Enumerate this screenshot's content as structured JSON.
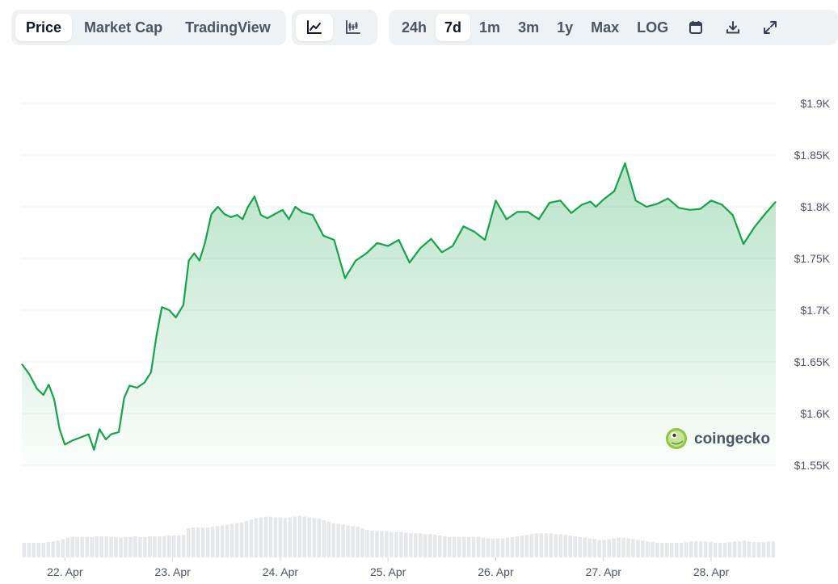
{
  "toolbar": {
    "type_tabs": [
      {
        "label": "Price",
        "active": true
      },
      {
        "label": "Market Cap",
        "active": false
      },
      {
        "label": "TradingView",
        "active": false
      }
    ],
    "view_buttons": [
      {
        "icon": "line-chart-icon",
        "active": true
      },
      {
        "icon": "candlestick-chart-icon",
        "active": false
      }
    ],
    "ranges": [
      {
        "label": "24h",
        "active": false
      },
      {
        "label": "7d",
        "active": true
      },
      {
        "label": "1m",
        "active": false
      },
      {
        "label": "3m",
        "active": false
      },
      {
        "label": "1y",
        "active": false
      },
      {
        "label": "Max",
        "active": false
      },
      {
        "label": "LOG",
        "active": false
      }
    ],
    "actions": [
      {
        "icon": "calendar-icon"
      },
      {
        "icon": "download-icon"
      },
      {
        "icon": "expand-icon"
      }
    ]
  },
  "watermark": {
    "text": "coingecko",
    "icon": "coingecko-logo-icon"
  },
  "colors": {
    "line": "#16a34a",
    "fill": "#bbf7d0",
    "volume": "#e5e7eb",
    "grid": "#eef0f3"
  },
  "chart_data": {
    "type": "area",
    "ylim": [
      1550,
      1900
    ],
    "y_ticks": [
      1550,
      1600,
      1650,
      1700,
      1750,
      1800,
      1850,
      1900
    ],
    "y_tick_labels": [
      "$1.55K",
      "$1.6K",
      "$1.65K",
      "$1.7K",
      "$1.75K",
      "$1.8K",
      "$1.85K",
      "$1.9K"
    ],
    "xlim": [
      0,
      7
    ],
    "x_ticks": [
      0.4,
      1.4,
      2.4,
      3.4,
      4.4,
      5.4,
      6.4
    ],
    "x_tick_labels": [
      "22. Apr",
      "23. Apr",
      "24. Apr",
      "25. Apr",
      "26. Apr",
      "27. Apr",
      "28. Apr"
    ],
    "grid": true,
    "legend": "none",
    "series": [
      {
        "x": [
          0,
          0.07,
          0.14,
          0.2,
          0.25,
          0.3,
          0.35,
          0.4,
          0.47,
          0.55,
          0.62,
          0.67,
          0.72,
          0.78,
          0.83,
          0.9,
          0.95,
          1.0,
          1.07,
          1.14,
          1.2,
          1.25,
          1.3,
          1.37,
          1.43,
          1.5,
          1.55,
          1.6,
          1.65,
          1.7,
          1.76,
          1.82,
          1.88,
          1.94,
          2.0,
          2.05,
          2.1,
          2.16,
          2.22,
          2.28,
          2.35,
          2.42,
          2.48,
          2.54,
          2.6,
          2.7,
          2.8,
          2.9,
          3.0,
          3.1,
          3.2,
          3.3,
          3.4,
          3.5,
          3.6,
          3.7,
          3.8,
          3.9,
          4.0,
          4.1,
          4.2,
          4.3,
          4.4,
          4.5,
          4.6,
          4.7,
          4.8,
          4.9,
          5.0,
          5.1,
          5.2,
          5.28,
          5.33,
          5.4,
          5.5,
          5.6,
          5.7,
          5.8,
          5.9,
          6.0,
          6.1,
          6.2,
          6.3,
          6.4,
          6.5,
          6.6,
          6.7,
          6.8,
          6.9,
          7.0
        ],
        "y": [
          1648,
          1638,
          1624,
          1618,
          1628,
          1614,
          1585,
          1570,
          1574,
          1577,
          1580,
          1565,
          1585,
          1575,
          1580,
          1582,
          1615,
          1627,
          1625,
          1630,
          1640,
          1675,
          1703,
          1700,
          1693,
          1705,
          1748,
          1755,
          1748,
          1765,
          1793,
          1800,
          1793,
          1790,
          1792,
          1788,
          1800,
          1810,
          1792,
          1789,
          1793,
          1797,
          1788,
          1800,
          1795,
          1792,
          1772,
          1768,
          1731,
          1748,
          1755,
          1765,
          1762,
          1768,
          1746,
          1760,
          1769,
          1756,
          1762,
          1781,
          1776,
          1768,
          1806,
          1788,
          1795,
          1795,
          1788,
          1804,
          1806,
          1794,
          1802,
          1805,
          1800,
          1807,
          1815,
          1842,
          1806,
          1800,
          1803,
          1808,
          1799,
          1797,
          1798,
          1806,
          1802,
          1792,
          1764,
          1780,
          1793,
          1805
        ]
      }
    ],
    "volume": [
      0.2,
      0.2,
      0.2,
      0.2,
      0.2,
      0.21,
      0.22,
      0.23,
      0.25,
      0.27,
      0.28,
      0.28,
      0.28,
      0.28,
      0.28,
      0.29,
      0.29,
      0.29,
      0.28,
      0.28,
      0.27,
      0.28,
      0.28,
      0.29,
      0.28,
      0.28,
      0.29,
      0.29,
      0.29,
      0.29,
      0.3,
      0.3,
      0.3,
      0.31,
      0.4,
      0.41,
      0.41,
      0.41,
      0.41,
      0.42,
      0.43,
      0.44,
      0.45,
      0.46,
      0.47,
      0.48,
      0.5,
      0.52,
      0.54,
      0.55,
      0.56,
      0.56,
      0.55,
      0.55,
      0.54,
      0.55,
      0.56,
      0.57,
      0.56,
      0.55,
      0.54,
      0.53,
      0.51,
      0.49,
      0.47,
      0.46,
      0.45,
      0.44,
      0.43,
      0.42,
      0.4,
      0.38,
      0.37,
      0.36,
      0.36,
      0.36,
      0.35,
      0.35,
      0.35,
      0.34,
      0.33,
      0.33,
      0.33,
      0.32,
      0.32,
      0.31,
      0.3,
      0.29,
      0.28,
      0.28,
      0.28,
      0.28,
      0.28,
      0.28,
      0.28,
      0.27,
      0.26,
      0.26,
      0.26,
      0.26,
      0.27,
      0.28,
      0.29,
      0.3,
      0.31,
      0.32,
      0.33,
      0.33,
      0.33,
      0.33,
      0.32,
      0.32,
      0.31,
      0.3,
      0.29,
      0.28,
      0.27,
      0.26,
      0.25,
      0.24,
      0.24,
      0.25,
      0.26,
      0.27,
      0.27,
      0.26,
      0.25,
      0.24,
      0.23,
      0.22,
      0.21,
      0.2,
      0.2,
      0.2,
      0.2,
      0.2,
      0.2,
      0.21,
      0.22,
      0.22,
      0.22,
      0.22,
      0.21,
      0.2,
      0.2,
      0.2,
      0.21,
      0.22,
      0.22,
      0.23,
      0.22,
      0.21,
      0.21,
      0.21,
      0.22,
      0.22
    ]
  }
}
